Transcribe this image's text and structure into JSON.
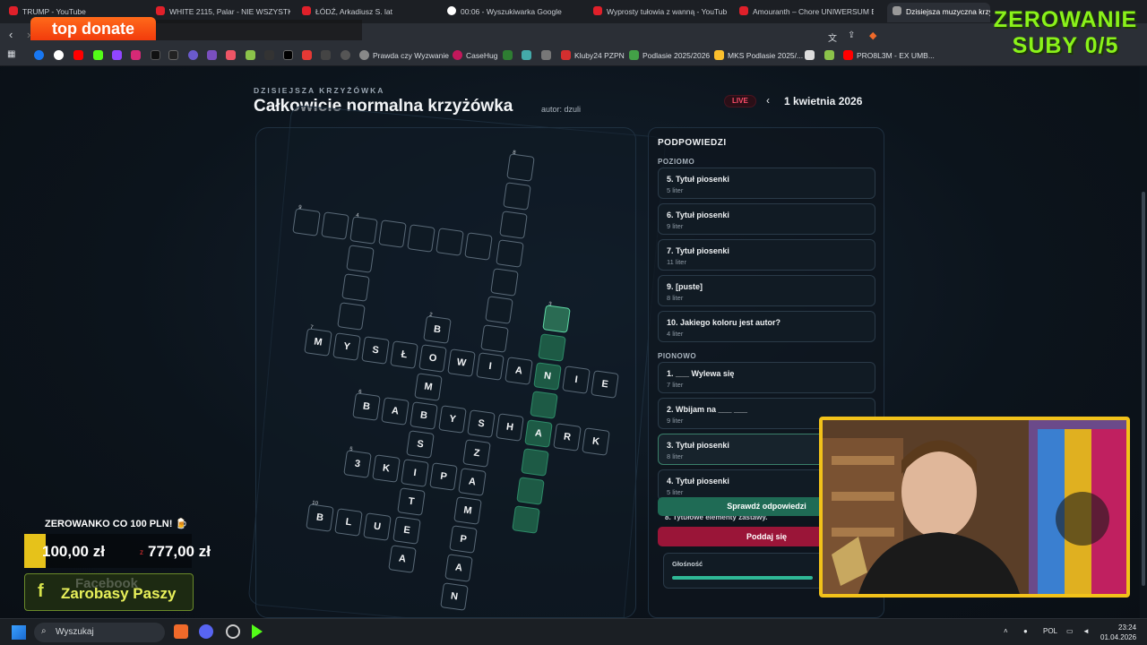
{
  "browser": {
    "tabs": [
      {
        "label": "TRUMP - YouTube"
      },
      {
        "label": "WHITE 2115, Palar - NIE WSZYSTKO"
      },
      {
        "label": "ŁÓDŹ, Arkadiusz S. lat"
      },
      {
        "label": "00:06 - Wyszukiwarka Google"
      },
      {
        "label": "Wyprosty tułowia z wanną - YouTub"
      },
      {
        "label": "Amouranth – Chore UNIWERSUM BA"
      },
      {
        "label": "Dzisiejsza muzyczna krzyż"
      }
    ],
    "bookmarks": [
      "Prawda czy Wyzwanie",
      "CaseHug",
      "Kluby24 PZPN",
      "Podlasie 2025/2026",
      "MKS Podlasie 2025/...",
      "PRO8L3M - EX UMB..."
    ]
  },
  "page": {
    "eyebrow": "DZISIEJSZA KRZYŻÓWKA",
    "title": "Całkowicie normalna krzyżówka",
    "author": "autor: dzuli",
    "live": "LIVE",
    "prev_icon": "‹",
    "date": "1 kwietnia 2026"
  },
  "clues": {
    "heading": "PODPOWIEDZI",
    "across_label": "POZIOMO",
    "down_label": "PIONOWO",
    "across": [
      {
        "title": "5. Tytuł piosenki",
        "sub": "5 liter"
      },
      {
        "title": "6. Tytuł piosenki",
        "sub": "9 liter"
      },
      {
        "title": "7. Tytuł piosenki",
        "sub": "11 liter"
      },
      {
        "title": "9. [puste]",
        "sub": "8 liter"
      },
      {
        "title": "10. Jakiego koloru jest autor?",
        "sub": "4 liter"
      }
    ],
    "down": [
      {
        "title": "1. ___ Wylewa się",
        "sub": "7 liter"
      },
      {
        "title": "2. Wbijam na ___ ___",
        "sub": "9 liter"
      },
      {
        "title": "3. Tytuł piosenki",
        "sub": "8 liter"
      },
      {
        "title": "4. Tytuł piosenki",
        "sub": "5 liter"
      }
    ],
    "partial_clue": "8. Tytułowe elementy zastawy.",
    "check_label": "Sprawdź odpowiedzi",
    "giveup_label": "Poddaj się",
    "volume_label": "Głośność",
    "volume_level": 0.72
  },
  "overlay": {
    "top_donate": "top donate",
    "zero_line1": "ZEROWANIE",
    "zero_line2": "SUBY 0/5",
    "goal_title": "ZEROWANKO CO 100 PLN! 🍺",
    "goal_current": "100,00 zł",
    "goal_sep": "z",
    "goal_max": "777,00 zł",
    "goal_progress": 0.13,
    "fb_ghost": "Facebook",
    "fb_name": "Zarobasy Paszy",
    "colors": {
      "donate": "#f23b0c",
      "zerowanie": "#8af21a",
      "cam_border": "#f2c21a",
      "check_btn": "#1f6b55",
      "giveup_btn": "#9a1538"
    }
  },
  "taskbar": {
    "search_placeholder": "Wyszukaj",
    "lang": "POL",
    "time": "23:24",
    "date": "01.04.2026"
  }
}
